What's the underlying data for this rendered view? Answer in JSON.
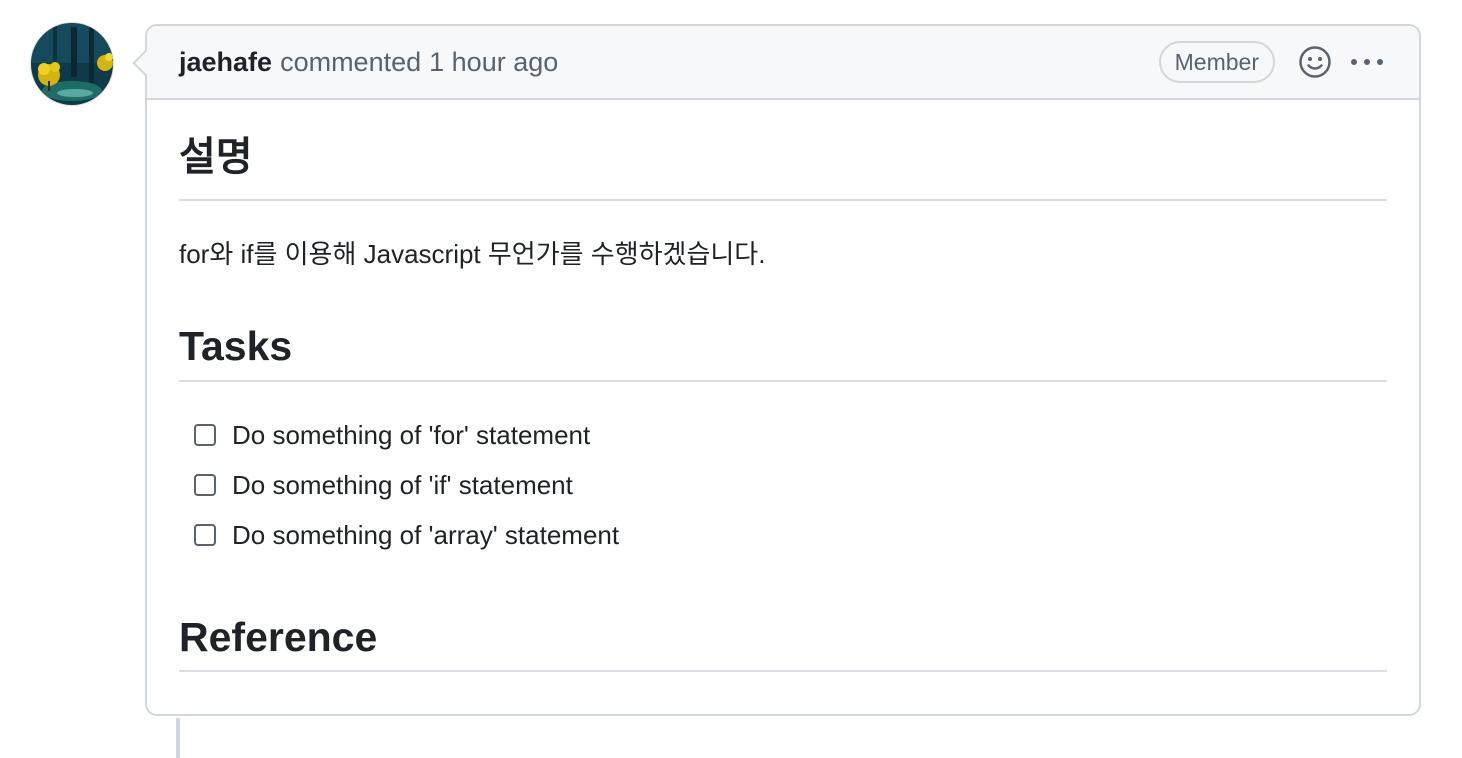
{
  "comment": {
    "author": "jaehafe",
    "action": "commented",
    "time": "1 hour ago",
    "badge": "Member",
    "emoji_icon": "smiley-icon",
    "more_icon": "kebab-horizontal-icon"
  },
  "body": {
    "heading_description": "설명",
    "description": "for와 if를 이용해 Javascript 무언가를 수행하겠습니다.",
    "heading_tasks": "Tasks",
    "tasks": [
      {
        "label": "Do something of 'for' statement",
        "checked": false
      },
      {
        "label": "Do something of 'if' statement",
        "checked": false
      },
      {
        "label": "Do something of 'array' statement",
        "checked": false
      }
    ],
    "heading_reference": "Reference"
  }
}
